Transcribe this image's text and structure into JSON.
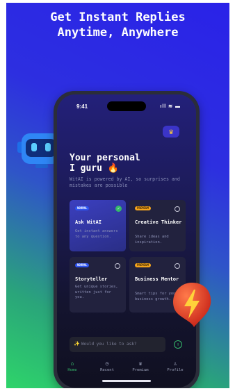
{
  "headline": {
    "line1": "Get Instant Replies",
    "line2": "Anytime, Anywhere"
  },
  "status_bar": {
    "time": "9:41",
    "icons": "ıll ≋ ▬"
  },
  "header": {
    "title_line1": "Your personal",
    "title_line2": "I guru 🔥",
    "subtitle": "WitAI is powered by AI, so surprises and mistakes are possible"
  },
  "cards": [
    {
      "badge": "NORMAL",
      "name": "Ask WitAI",
      "desc": "Get instant answers to any question.",
      "selected": true
    },
    {
      "badge": "PREMIUM",
      "name": "Creative Thinker",
      "desc": "Share ideas and inspiration.",
      "selected": false
    },
    {
      "badge": "NORMAL",
      "name": "Storyteller",
      "desc": "Get unique stories, written just for you.",
      "selected": false
    },
    {
      "badge": "PREMIUM",
      "name": "Business Mentor",
      "desc": "Smart tips for your business growth.",
      "selected": false
    }
  ],
  "ask": {
    "placeholder": "Would you like to ask?"
  },
  "nav": [
    {
      "label": "Home",
      "icon": "home-icon",
      "glyph": "⌂"
    },
    {
      "label": "Recent",
      "icon": "clock-icon",
      "glyph": "◷"
    },
    {
      "label": "Premium",
      "icon": "crown-icon",
      "glyph": "♛"
    },
    {
      "label": "Profile",
      "icon": "user-icon",
      "glyph": "♙"
    }
  ],
  "colors": {
    "accent_green": "#35b86a",
    "brand_blue": "#2a22e8",
    "premium_orange": "#f5a51d",
    "bolt_red": "#e8402a"
  }
}
